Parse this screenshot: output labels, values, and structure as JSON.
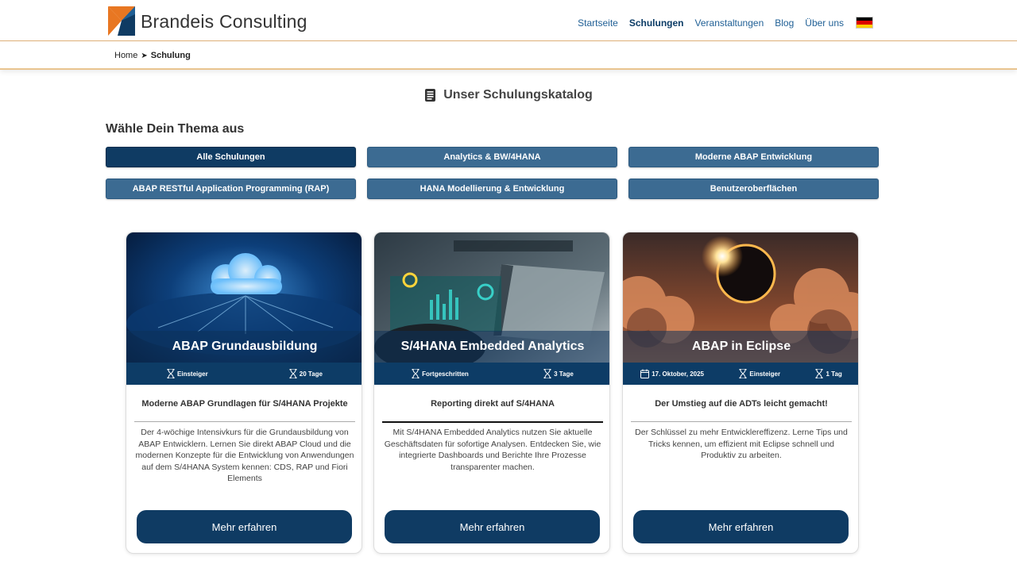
{
  "header": {
    "brand": "Brandeis Consulting",
    "nav": [
      "Startseite",
      "Schulungen",
      "Veranstaltungen",
      "Blog",
      "Über uns"
    ],
    "active_nav": "Schulungen"
  },
  "breadcrumb": {
    "home": "Home",
    "separator": "➤",
    "current": "Schulung"
  },
  "catalog": {
    "title": "Unser Schulungskatalog",
    "theme_heading": "Wähle Dein Thema aus"
  },
  "filters": [
    "Alle Schulungen",
    "Analytics & BW/4HANA",
    "Moderne ABAP Entwicklung",
    "ABAP RESTful Application Programming (RAP)",
    "HANA Modellierung & Entwicklung",
    "Benutzeroberflächen"
  ],
  "cards": [
    {
      "title": "ABAP Grundausbildung",
      "level": "Einsteiger",
      "duration": "20 Tage",
      "subtitle": "Moderne ABAP Grundlagen für S/4HANA Projekte",
      "description": "Der 4-wöchige Intensivkurs für die Grundausbildung von ABAP Entwicklern. Lernen Sie direkt ABAP Cloud und die modernen Konzepte für die Entwicklung von Anwendungen auf dem S/4HANA System kennen: CDS, RAP und Fiori Elements",
      "button": "Mehr erfahren"
    },
    {
      "title": "S/4HANA Embedded Analytics",
      "level": "Fortgeschritten",
      "duration": "3 Tage",
      "subtitle": "Reporting direkt auf S/4HANA",
      "description": "Mit S/4HANA Embedded Analytics nutzen Sie aktuelle Geschäftsdaten für sofortige Analysen. Entdecken Sie, wie integrierte Dashboards und Berichte Ihre Prozesse transparenter machen.",
      "button": "Mehr erfahren"
    },
    {
      "title": "ABAP in Eclipse",
      "date": "17. Oktober, 2025",
      "level": "Einsteiger",
      "duration": "1 Tag",
      "subtitle": "Der Umstieg auf die ADTs leicht gemacht!",
      "description": "Der Schlüssel zu mehr Entwicklereffizenz. Lerne Tips und Tricks kennen, um effizient mit Eclipse schnell und Produktiv zu arbeiten.",
      "button": "Mehr erfahren"
    }
  ],
  "colors": {
    "primary": "#0f3b63",
    "filter": "#3c6b92",
    "accent": "#e87722"
  },
  "icons": {
    "catalog": "book-icon",
    "level": "hourglass-icon",
    "duration": "hourglass-icon",
    "date": "calendar-icon",
    "language": "german-flag-icon"
  }
}
